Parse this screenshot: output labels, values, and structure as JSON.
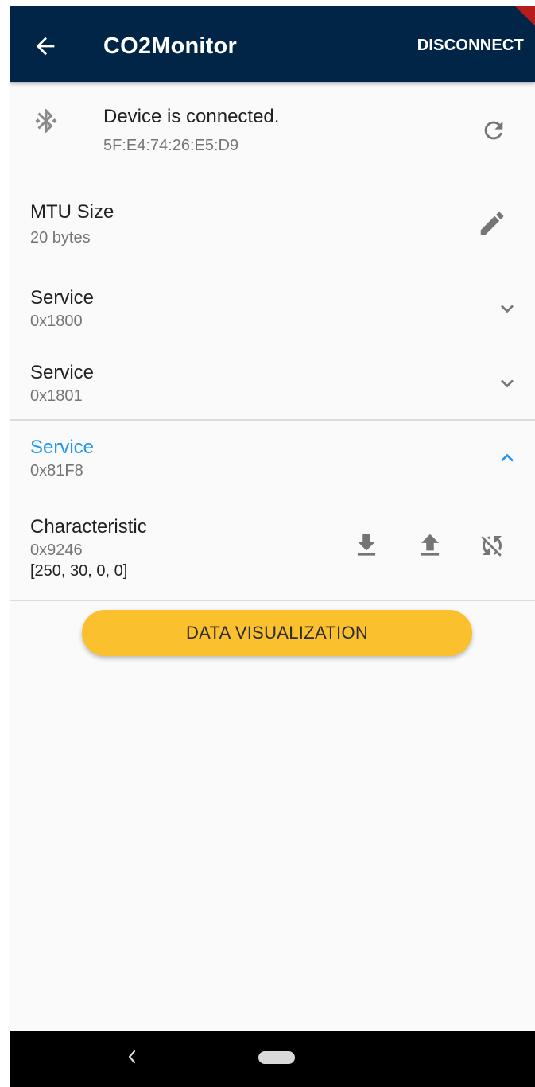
{
  "appbar": {
    "title": "CO2Monitor",
    "disconnect_label": "DISCONNECT"
  },
  "device": {
    "status": "Device is connected.",
    "address": "5F:E4:74:26:E5:D9"
  },
  "mtu": {
    "title": "MTU Size",
    "value": "20 bytes"
  },
  "services": [
    {
      "label": "Service",
      "uuid": "0x1800",
      "expanded": false
    },
    {
      "label": "Service",
      "uuid": "0x1801",
      "expanded": false
    },
    {
      "label": "Service",
      "uuid": "0x81F8",
      "expanded": true
    }
  ],
  "characteristic": {
    "label": "Characteristic",
    "uuid": "0x9246",
    "value": "[250, 30, 0, 0]"
  },
  "data_visualization_label": "DATA VISUALIZATION",
  "colors": {
    "appbar": "#002546",
    "accent": "#2196f3",
    "button": "#fbc02d"
  }
}
